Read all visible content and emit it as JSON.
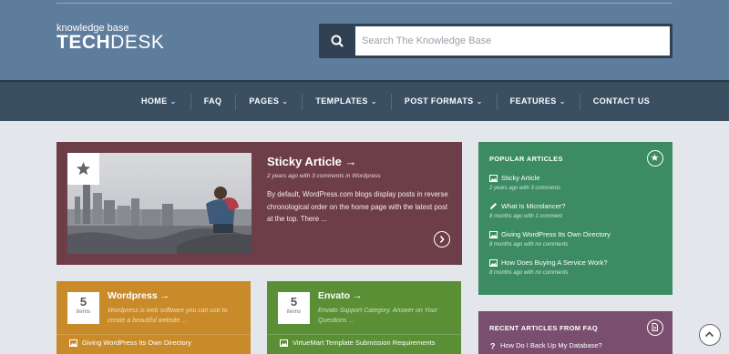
{
  "logo": {
    "small": "knowledge base",
    "bold": "TECH",
    "light": "DESK"
  },
  "search": {
    "placeholder": "Search The Knowledge Base",
    "icon": "search-icon"
  },
  "nav": {
    "items": [
      {
        "label": "HOME",
        "caret": "⌄"
      },
      {
        "label": "FAQ"
      },
      {
        "label": "PAGES",
        "caret": "⌄"
      },
      {
        "label": "TEMPLATES",
        "caret": "⌄"
      },
      {
        "label": "POST FORMATS",
        "caret": "⌄"
      },
      {
        "label": "FEATURES",
        "caret": "⌄"
      },
      {
        "label": "CONTACT US"
      }
    ]
  },
  "sticky": {
    "title": "Sticky Article →",
    "meta": "2 years ago with 3 comments in Wordpress",
    "excerpt": "By default, WordPress.com blogs display posts in reverse chronological order on the home page with the latest post at the top. There ...",
    "color": "#6e3e48"
  },
  "popular": {
    "title": "POPULAR ARTICLES",
    "color": "#3c8b63",
    "items": [
      {
        "title": "Sticky Article",
        "meta": "2 years ago with 3 comments",
        "icon": "image-icon"
      },
      {
        "title": "What Is Microlancer?",
        "meta": "8 months ago with 1 comment",
        "icon": "pencil-icon"
      },
      {
        "title": "Giving WordPress Its Own Directory",
        "meta": "8 months ago with no comments",
        "icon": "image-icon"
      },
      {
        "title": "How Does Buying A Service Work?",
        "meta": "8 months ago with no comments",
        "icon": "image-icon"
      }
    ]
  },
  "faq": {
    "title": "RECENT ARTICLES FROM FAQ",
    "color": "#7a4e6e",
    "items": [
      {
        "title": "How Do I Back Up My Database?"
      }
    ]
  },
  "categories": [
    {
      "count": "5",
      "count_label": "items",
      "title": "Wordpress →",
      "desc": "Wordpress is web software you can use to create a beautiful website ...",
      "item": "Giving WordPress Its Own Directory",
      "color": "#c98b2a"
    },
    {
      "count": "5",
      "count_label": "items",
      "title": "Envato →",
      "desc": "Envato Support Category. Answer on Your Questions ...",
      "item": "VirtueMart Template Submission Requirements",
      "color": "#5a8f36"
    }
  ]
}
